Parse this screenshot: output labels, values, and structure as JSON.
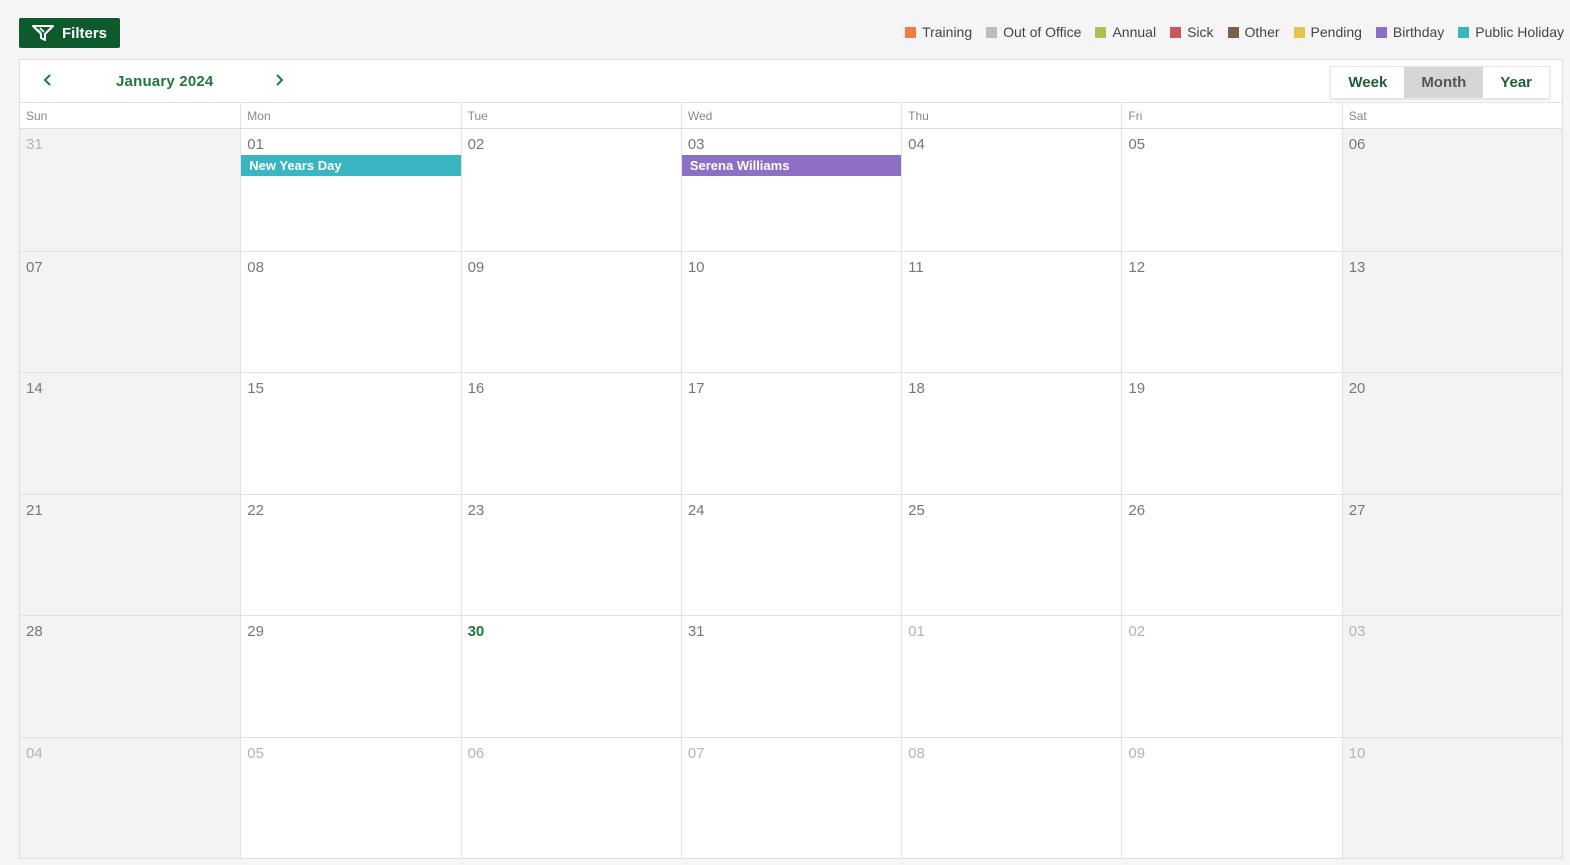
{
  "filters": {
    "label": "Filters"
  },
  "legend": [
    {
      "label": "Training",
      "color": "#f47c42"
    },
    {
      "label": "Out of Office",
      "color": "#bdbdbd"
    },
    {
      "label": "Annual",
      "color": "#a5c44f"
    },
    {
      "label": "Sick",
      "color": "#c9575a"
    },
    {
      "label": "Other",
      "color": "#7a6048"
    },
    {
      "label": "Pending",
      "color": "#e8c54a"
    },
    {
      "label": "Birthday",
      "color": "#8d6fc6"
    },
    {
      "label": "Public Holiday",
      "color": "#3ab5c2"
    }
  ],
  "calendar": {
    "title": "January 2024",
    "views": [
      {
        "label": "Week",
        "active": false
      },
      {
        "label": "Month",
        "active": true
      },
      {
        "label": "Year",
        "active": false
      }
    ],
    "days": [
      "Sun",
      "Mon",
      "Tue",
      "Wed",
      "Thu",
      "Fri",
      "Sat"
    ],
    "weeks": [
      [
        {
          "num": "31",
          "muted": true
        },
        {
          "num": "01",
          "event": {
            "label": "New Years Day",
            "color": "#3ab5c2"
          }
        },
        {
          "num": "02"
        },
        {
          "num": "03",
          "event": {
            "label": "Serena Williams",
            "color": "#8d6fc6"
          }
        },
        {
          "num": "04"
        },
        {
          "num": "05"
        },
        {
          "num": "06"
        }
      ],
      [
        {
          "num": "07"
        },
        {
          "num": "08"
        },
        {
          "num": "09"
        },
        {
          "num": "10"
        },
        {
          "num": "11"
        },
        {
          "num": "12"
        },
        {
          "num": "13"
        }
      ],
      [
        {
          "num": "14"
        },
        {
          "num": "15"
        },
        {
          "num": "16"
        },
        {
          "num": "17"
        },
        {
          "num": "18"
        },
        {
          "num": "19"
        },
        {
          "num": "20"
        }
      ],
      [
        {
          "num": "21"
        },
        {
          "num": "22"
        },
        {
          "num": "23"
        },
        {
          "num": "24"
        },
        {
          "num": "25"
        },
        {
          "num": "26"
        },
        {
          "num": "27"
        }
      ],
      [
        {
          "num": "28"
        },
        {
          "num": "29"
        },
        {
          "num": "30",
          "today": true
        },
        {
          "num": "31"
        },
        {
          "num": "01",
          "muted": true
        },
        {
          "num": "02",
          "muted": true
        },
        {
          "num": "03",
          "muted": true
        }
      ],
      [
        {
          "num": "04",
          "muted": true
        },
        {
          "num": "05",
          "muted": true
        },
        {
          "num": "06",
          "muted": true
        },
        {
          "num": "07",
          "muted": true
        },
        {
          "num": "08",
          "muted": true
        },
        {
          "num": "09",
          "muted": true
        },
        {
          "num": "10",
          "muted": true
        }
      ]
    ]
  }
}
